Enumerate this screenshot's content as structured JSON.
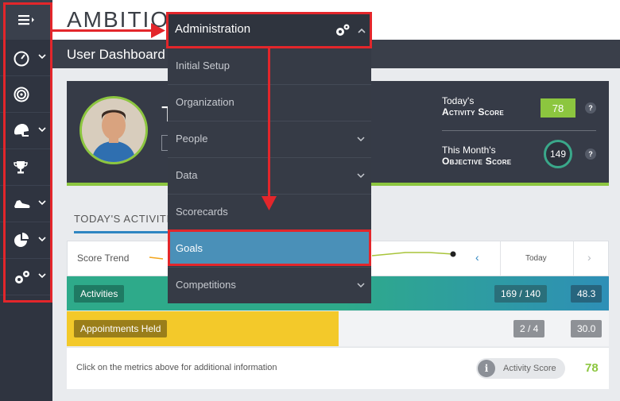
{
  "app": {
    "logo_text": "AMBITION",
    "page_title": "User Dashboard"
  },
  "profile": {
    "name_initial": "T",
    "activity_score_label_top": "Today's",
    "activity_score_label_main": "Activity Score",
    "activity_score_value": "78",
    "objective_score_label_top": "This Month's",
    "objective_score_label_main": "Objective Score",
    "objective_score_value": "149",
    "help_glyph": "?"
  },
  "dropdown": {
    "header_label": "Administration",
    "items": [
      {
        "label": "Initial Setup",
        "has_chevron": false
      },
      {
        "label": "Organization",
        "has_chevron": false
      },
      {
        "label": "People",
        "has_chevron": true
      },
      {
        "label": "Data",
        "has_chevron": true
      },
      {
        "label": "Scorecards",
        "has_chevron": false
      },
      {
        "label": "Goals",
        "has_chevron": false,
        "selected": true
      },
      {
        "label": "Competitions",
        "has_chevron": true
      }
    ]
  },
  "activities": {
    "section_title": "TODAY'S ACTIVITIE",
    "trend_label": "Score Trend",
    "nav_today": "Today",
    "nav_prev_glyph": "‹",
    "nav_next_glyph": "›",
    "rows": [
      {
        "label": "Activities",
        "progress": "169 / 140",
        "score": "48.3"
      },
      {
        "label": "Appointments Held",
        "progress": "2 / 4",
        "score": "30.0"
      }
    ],
    "info_text": "Click on the metrics above for additional information",
    "pill_glyph": "i",
    "pill_label": "Activity Score",
    "pill_value": "78"
  },
  "sidebar": {
    "icons": [
      "menu-icon",
      "dashboard-gauge-icon",
      "target-icon",
      "helmet-icon",
      "trophy-icon",
      "sneaker-icon",
      "pie-chart-icon",
      "gears-icon"
    ]
  },
  "colors": {
    "highlight": "#e3262b",
    "accent_green": "#8cc63f",
    "accent_blue": "#2f86c2",
    "teal": "#2eaa8a",
    "yellow": "#f3c92a",
    "dark": "#363b46"
  }
}
